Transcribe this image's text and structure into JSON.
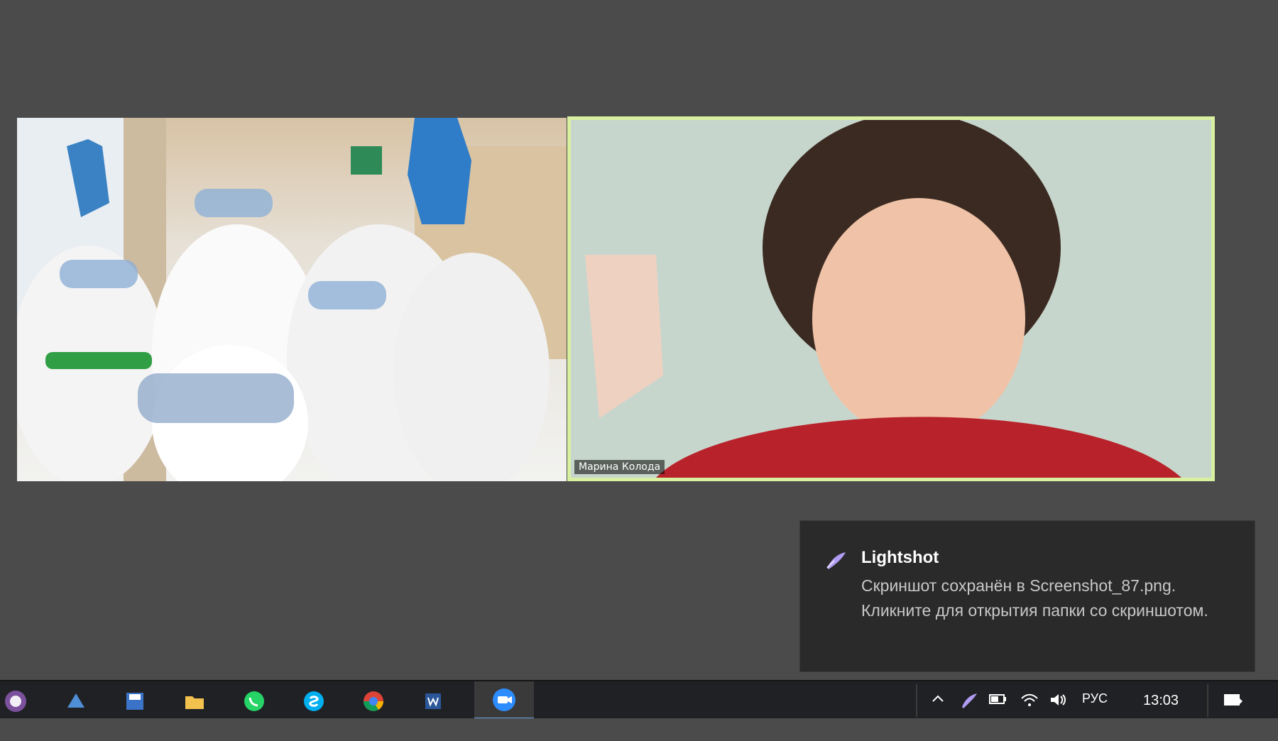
{
  "meeting": {
    "participants": [
      {
        "id": "left",
        "name": ""
      },
      {
        "id": "right",
        "name": "Марина Колода"
      }
    ]
  },
  "notification": {
    "title": "Lightshot",
    "message": "Скриншот сохранён в Screenshot_87.png. Кликните для открытия папки со скриншотом."
  },
  "taskbar": {
    "apps": [
      {
        "name": "viber-icon",
        "color": "#7b519d"
      },
      {
        "name": "network-icon",
        "color": "#4f8fd8"
      },
      {
        "name": "save-icon",
        "color": "#3b73c8"
      },
      {
        "name": "folder-icon",
        "color": "#f2c14e"
      },
      {
        "name": "whatsapp-icon",
        "color": "#25d366"
      },
      {
        "name": "skype-icon",
        "color": "#00aff0"
      },
      {
        "name": "chrome-icon",
        "color": "#db4437"
      },
      {
        "name": "word-icon",
        "color": "#2b579a"
      },
      {
        "name": "zoom-icon",
        "color": "#2d8cff"
      }
    ],
    "tray": {
      "language": "РУС",
      "time": "13:03"
    }
  }
}
